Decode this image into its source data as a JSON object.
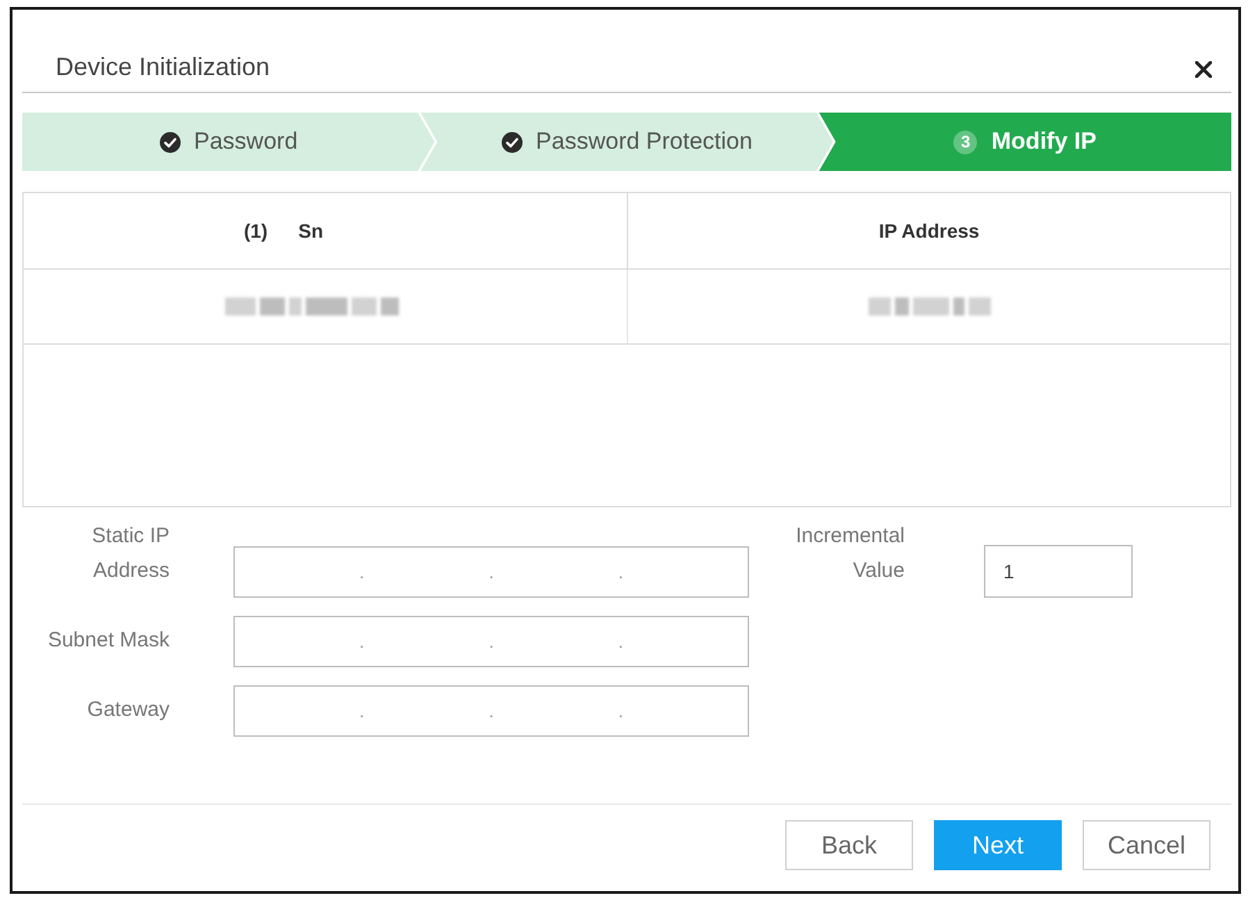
{
  "dialog": {
    "title": "Device Initialization"
  },
  "steps": [
    {
      "label": "Password",
      "completed": true,
      "selected": false
    },
    {
      "label": "Password Protection",
      "completed": true,
      "selected": false
    },
    {
      "number": "3",
      "label": "Modify IP",
      "completed": false,
      "selected": true
    }
  ],
  "table": {
    "count": "(1)",
    "columns": [
      "Sn",
      "IP Address"
    ],
    "rows": [
      {
        "sn": {
          "redacted": true
        },
        "ip_address": {
          "redacted": true
        }
      }
    ]
  },
  "form": {
    "fields": [
      {
        "label": "Static IP Address",
        "kind": "ip",
        "separators": [
          ".",
          ".",
          "."
        ]
      },
      {
        "label": "Subnet Mask",
        "kind": "ip",
        "separators": [
          ".",
          ".",
          "."
        ]
      },
      {
        "label": "Gateway",
        "kind": "ip",
        "separators": [
          ".",
          ".",
          "."
        ]
      }
    ],
    "incremental": {
      "label": "Incremental Value",
      "value": "1"
    }
  },
  "buttons": [
    {
      "label": "Back",
      "primary": false
    },
    {
      "label": "Next",
      "primary": true
    },
    {
      "label": "Cancel",
      "primary": false
    }
  ]
}
